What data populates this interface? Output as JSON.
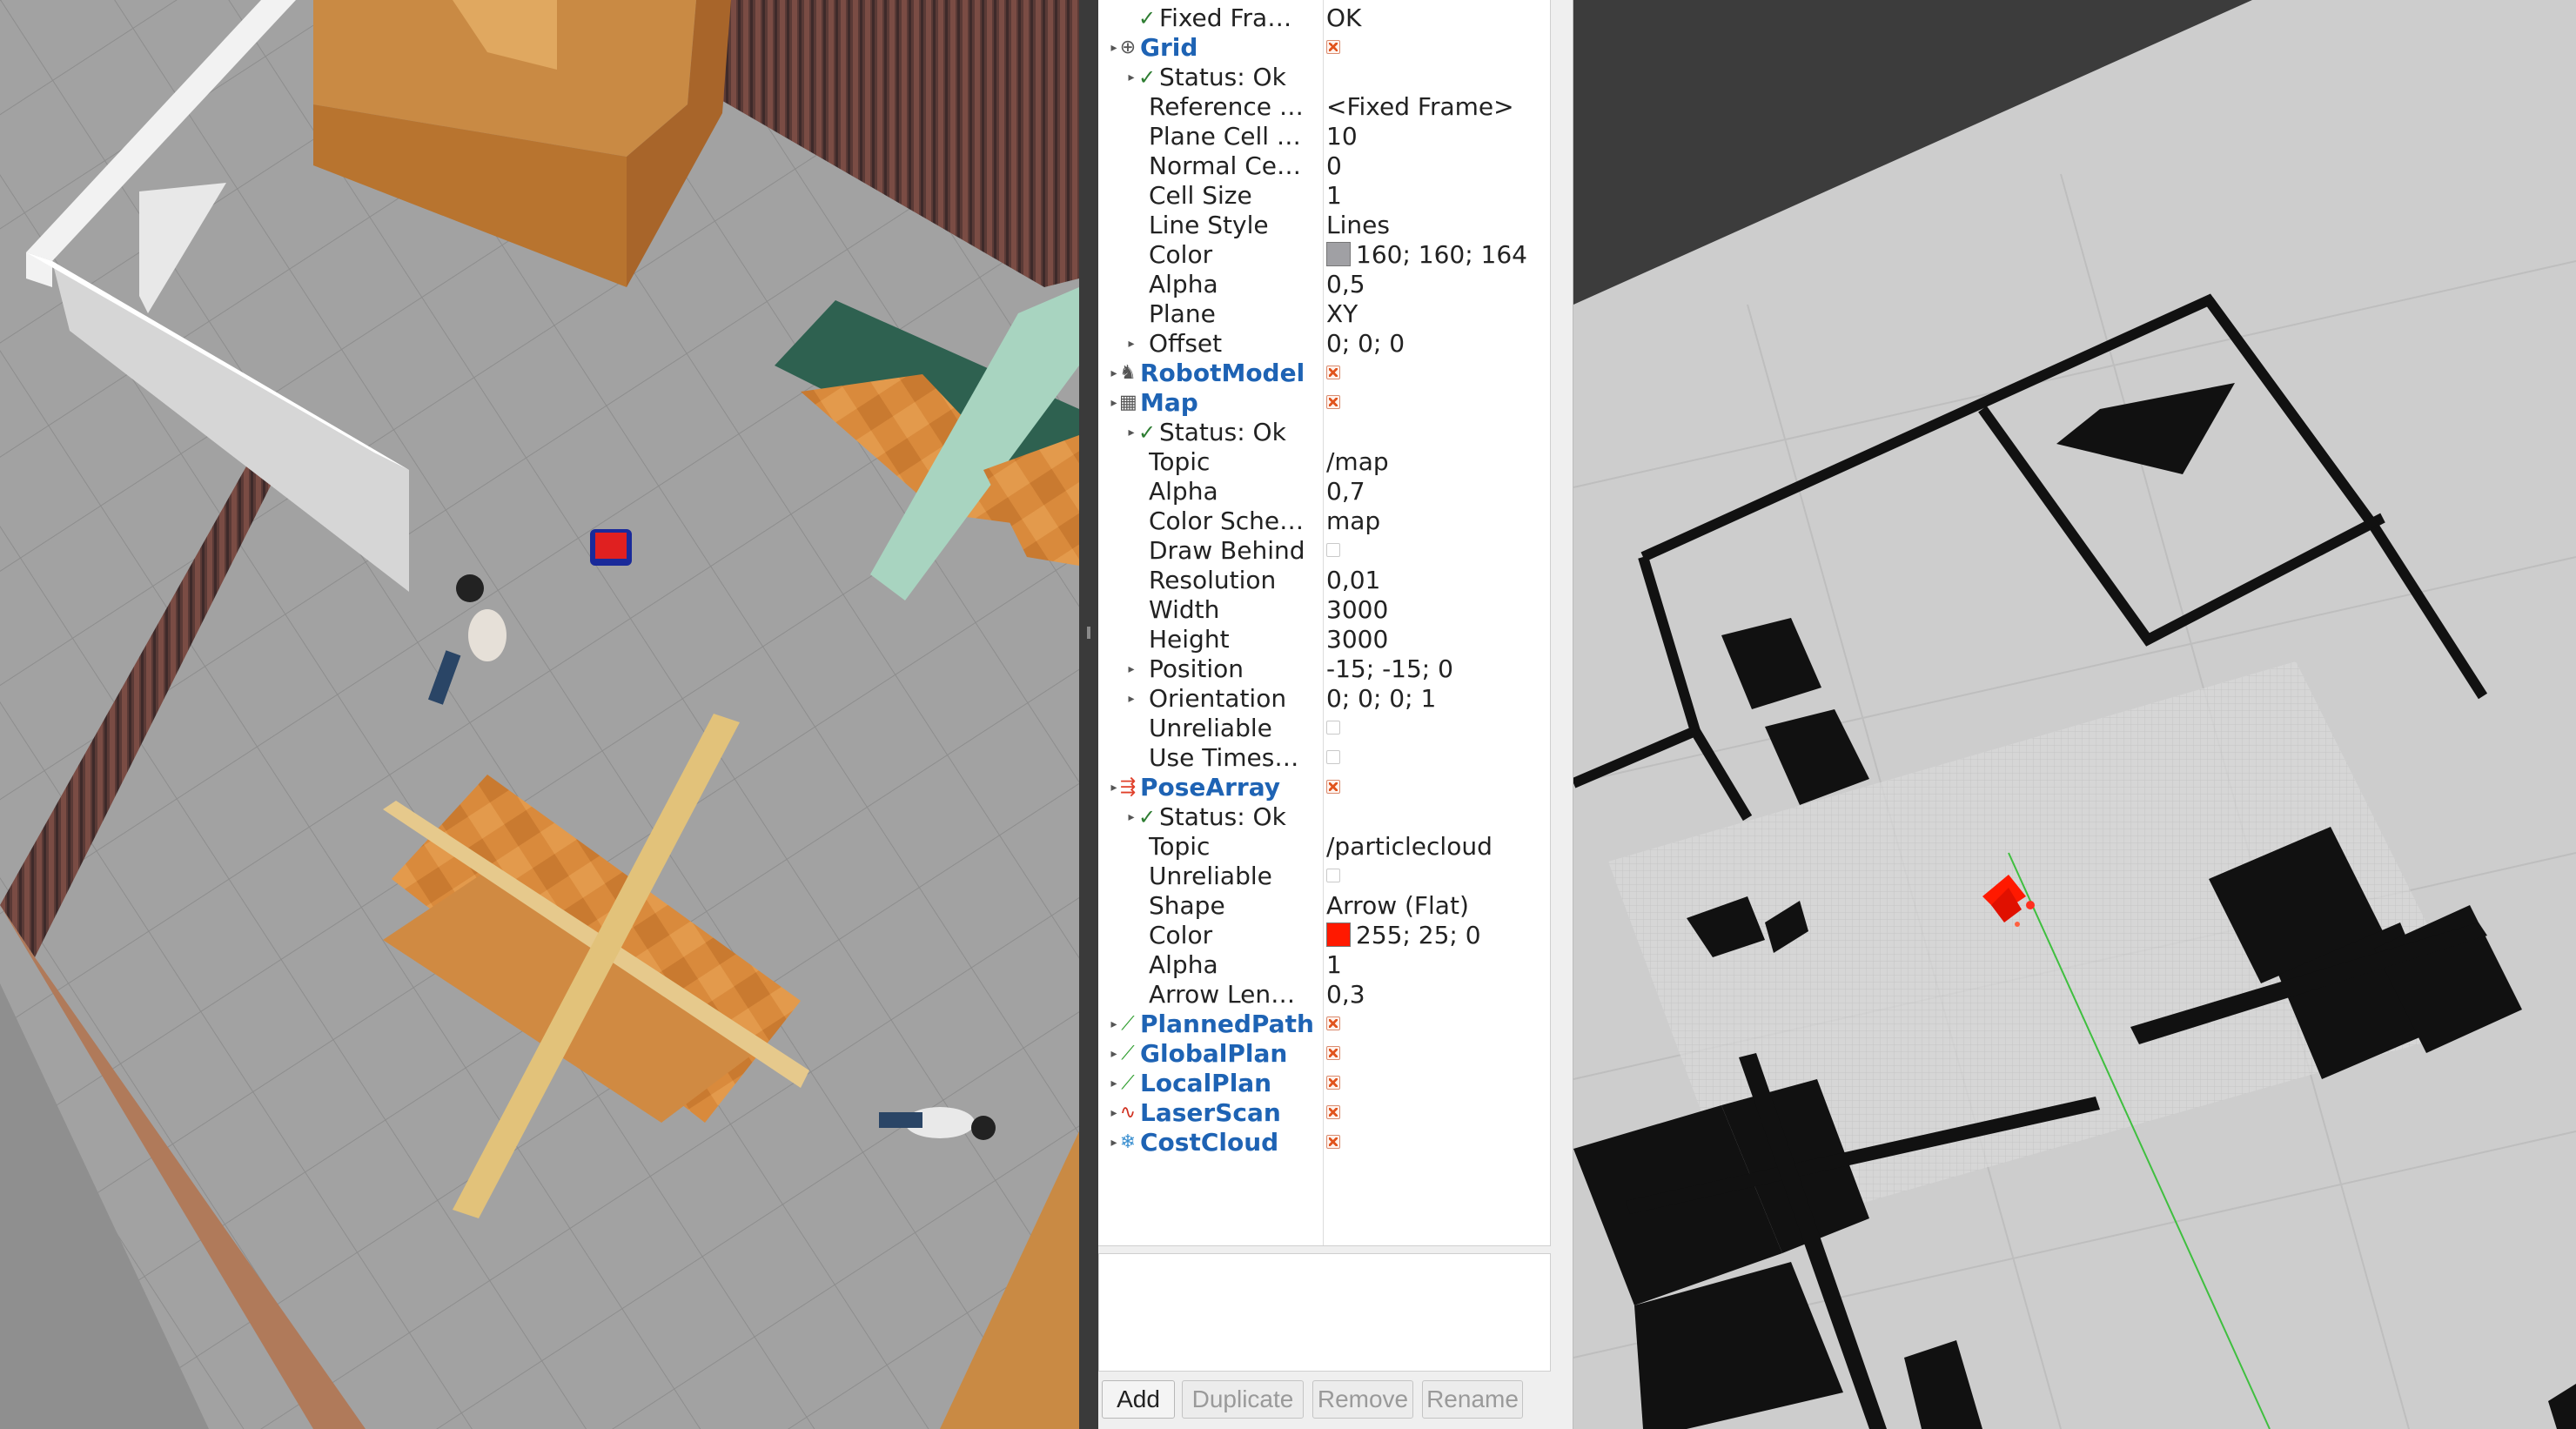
{
  "displays": {
    "rows": [
      {
        "label": "Fixed Fra…",
        "value": "OK",
        "status": true
      },
      {
        "label": "Grid",
        "display": true,
        "icon": "grid-icon",
        "color": "#555555",
        "glyph": "⊕",
        "checked": true
      },
      {
        "label": "Status: Ok",
        "status": true
      },
      {
        "label": "Reference …",
        "value": "<Fixed Frame>"
      },
      {
        "label": "Plane Cell …",
        "value": "10"
      },
      {
        "label": "Normal Ce…",
        "value": "0"
      },
      {
        "label": "Cell Size",
        "value": "1"
      },
      {
        "label": "Line Style",
        "value": "Lines"
      },
      {
        "label": "Color",
        "value": "160; 160; 164",
        "swatch": "#a0a0a4"
      },
      {
        "label": "Alpha",
        "value": "0,5"
      },
      {
        "label": "Plane",
        "value": "XY"
      },
      {
        "label": "Offset",
        "value": "0; 0; 0",
        "expand": true
      },
      {
        "label": "RobotModel",
        "display": true,
        "icon": "robot-model-icon",
        "color": "#555555",
        "glyph": "♞",
        "checked": true
      },
      {
        "label": "Map",
        "display": true,
        "icon": "map-icon",
        "color": "#555555",
        "glyph": "▦",
        "checked": true
      },
      {
        "label": "Status: Ok",
        "status": true
      },
      {
        "label": "Topic",
        "value": "/map"
      },
      {
        "label": "Alpha",
        "value": "0,7"
      },
      {
        "label": "Color Sche…",
        "value": "map"
      },
      {
        "label": "Draw Behind",
        "checkbox": false
      },
      {
        "label": "Resolution",
        "value": "0,01"
      },
      {
        "label": "Width",
        "value": "3000"
      },
      {
        "label": "Height",
        "value": "3000"
      },
      {
        "label": "Position",
        "value": "-15; -15; 0",
        "expand": true
      },
      {
        "label": "Orientation",
        "value": "0; 0; 0; 1",
        "expand": true
      },
      {
        "label": "Unreliable",
        "checkbox": false
      },
      {
        "label": "Use Times…",
        "checkbox": false
      },
      {
        "label": "PoseArray",
        "display": true,
        "icon": "pose-array-icon",
        "color": "#e0402a",
        "glyph": "⇶",
        "checked": true
      },
      {
        "label": "Status: Ok",
        "status": true
      },
      {
        "label": "Topic",
        "value": "/particlecloud"
      },
      {
        "label": "Unreliable",
        "checkbox": false
      },
      {
        "label": "Shape",
        "value": "Arrow (Flat)"
      },
      {
        "label": "Color",
        "value": "255; 25; 0",
        "swatch": "#ff1900"
      },
      {
        "label": "Alpha",
        "value": "1"
      },
      {
        "label": "Arrow Len…",
        "value": "0,3"
      },
      {
        "label": "PlannedPath",
        "display": true,
        "icon": "path-icon",
        "color": "#2e9e2e",
        "glyph": "⟋",
        "checked": true
      },
      {
        "label": "GlobalPlan",
        "display": true,
        "icon": "path-icon",
        "color": "#2e9e2e",
        "glyph": "⟋",
        "checked": true
      },
      {
        "label": "LocalPlan",
        "display": true,
        "icon": "path-icon",
        "color": "#2e9e2e",
        "glyph": "⟋",
        "checked": true
      },
      {
        "label": "LaserScan",
        "display": true,
        "icon": "laser-scan-icon",
        "color": "#d03020",
        "glyph": "∿",
        "checked": true
      },
      {
        "label": "CostCloud",
        "display": true,
        "icon": "point-cloud-icon",
        "color": "#3a8fd0",
        "glyph": "❄",
        "checked": true
      }
    ]
  },
  "buttons": {
    "add": "Add",
    "duplicate": "Duplicate",
    "remove": "Remove",
    "rename": "Rename"
  },
  "colors": {
    "rviz_background": "#3c3c3c",
    "map_free": "#c8c8c8",
    "map_occupied": "#111111",
    "particles": "#ff1900",
    "grid": "#a0a0a4"
  }
}
